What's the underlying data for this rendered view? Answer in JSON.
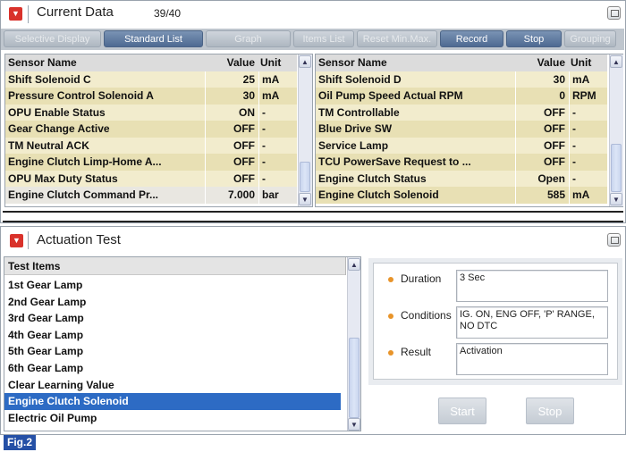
{
  "current_data": {
    "title": "Current Data",
    "count": "39/40",
    "toolbar": [
      {
        "label": "Selective Display",
        "state": "disabled"
      },
      {
        "label": "Standard List",
        "state": "active"
      },
      {
        "label": "Graph",
        "state": "disabled"
      },
      {
        "label": "Items List",
        "state": "disabled"
      },
      {
        "label": "Reset Min.Max.",
        "state": "disabled"
      },
      {
        "label": "Record",
        "state": "active"
      },
      {
        "label": "Stop",
        "state": "active"
      },
      {
        "label": "Grouping",
        "state": "disabled"
      }
    ],
    "columns": {
      "name": "Sensor Name",
      "value": "Value",
      "unit": "Unit"
    },
    "left_rows": [
      {
        "name": "Shift Solenoid C",
        "value": "25",
        "unit": "mA"
      },
      {
        "name": "Pressure Control Solenoid A",
        "value": "30",
        "unit": "mA"
      },
      {
        "name": "OPU Enable Status",
        "value": "ON",
        "unit": "-"
      },
      {
        "name": "Gear Change Active",
        "value": "OFF",
        "unit": "-"
      },
      {
        "name": "TM Neutral ACK",
        "value": "OFF",
        "unit": "-"
      },
      {
        "name": "Engine Clutch Limp-Home A...",
        "value": "OFF",
        "unit": "-"
      },
      {
        "name": "OPU Max Duty Status",
        "value": "OFF",
        "unit": "-"
      },
      {
        "name": "Engine Clutch Command Pr...",
        "value": "7.000",
        "unit": "bar"
      }
    ],
    "right_rows": [
      {
        "name": "Shift Solenoid D",
        "value": "30",
        "unit": "mA"
      },
      {
        "name": "Oil Pump Speed Actual RPM",
        "value": "0",
        "unit": "RPM"
      },
      {
        "name": "TM Controllable",
        "value": "OFF",
        "unit": "-"
      },
      {
        "name": "Blue Drive SW",
        "value": "OFF",
        "unit": "-"
      },
      {
        "name": "Service Lamp",
        "value": "OFF",
        "unit": "-"
      },
      {
        "name": "TCU PowerSave Request to ...",
        "value": "OFF",
        "unit": "-"
      },
      {
        "name": "Engine Clutch Status",
        "value": "Open",
        "unit": "-"
      },
      {
        "name": "Engine Clutch Solenoid",
        "value": "585",
        "unit": "mA"
      }
    ]
  },
  "actuation": {
    "title": "Actuation Test",
    "list_header": "Test Items",
    "items": [
      "1st Gear Lamp",
      "2nd Gear Lamp",
      "3rd Gear Lamp",
      "4th Gear Lamp",
      "5th Gear Lamp",
      "6th Gear Lamp",
      "Clear Learning Value",
      "Engine Clutch Solenoid",
      "Electric Oil Pump"
    ],
    "selected_item": "Engine Clutch Solenoid",
    "duration_label": "Duration",
    "duration_value": "3 Sec",
    "conditions_label": "Conditions",
    "conditions_value": "IG. ON, ENG OFF, 'P' RANGE, NO DTC",
    "result_label": "Result",
    "result_value": "Activation",
    "start_label": "Start",
    "stop_label": "Stop"
  },
  "figure_label": "Fig.2",
  "icons": {
    "collapse": "collapse-icon",
    "maximize": "maximize-icon",
    "scroll_up": "arrow-up-icon",
    "scroll_down": "arrow-down-icon",
    "dropdown": "up-down-arrows-icon"
  },
  "colors": {
    "accent_red": "#d9322b",
    "row_odd": "#f2eccd",
    "row_even": "#e8e0b4",
    "selected_blue": "#2d6bc4",
    "button_active": "#5b7aa2",
    "bullet_orange": "#e8942a"
  }
}
